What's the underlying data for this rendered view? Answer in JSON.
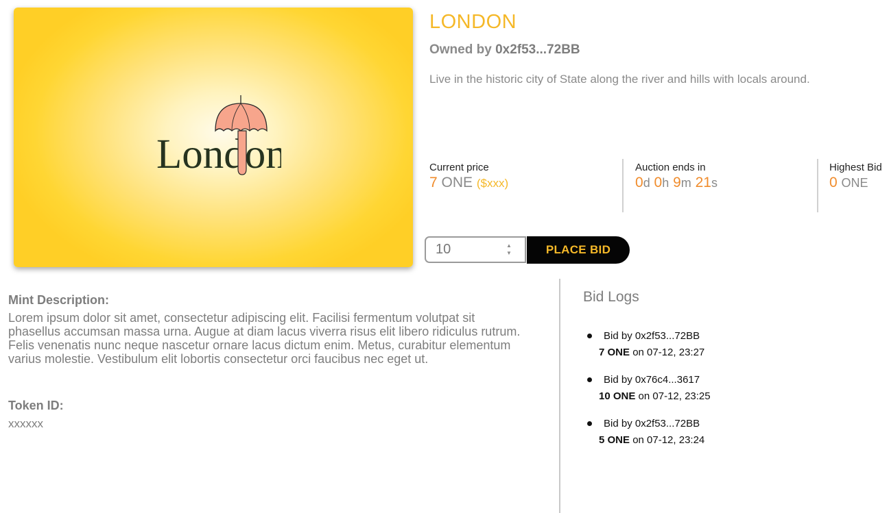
{
  "nft": {
    "image_text": "London",
    "icon": "umbrella-icon",
    "colors": {
      "background": "#ffd633",
      "umbrella": "#f7a58c",
      "text": "#26331f"
    }
  },
  "title": "LONDON",
  "owner": {
    "prefix": "Owned by",
    "address": "0x2f53...72BB"
  },
  "description": "Live in the historic city of State along the river and hills with locals around.",
  "stats": {
    "current_price": {
      "label": "Current price",
      "amount": "7",
      "currency": "ONE",
      "usd": "($xxx)"
    },
    "auction_ends": {
      "label": "Auction ends in",
      "days": "0",
      "days_unit": "d",
      "hours": "0",
      "hours_unit": "h",
      "minutes": "9",
      "minutes_unit": "m",
      "seconds": "21",
      "seconds_unit": "s"
    },
    "highest_bid": {
      "label": "Highest Bid",
      "amount": "0",
      "currency": "ONE"
    }
  },
  "bid_form": {
    "value": "10",
    "button_label": "PLACE BID"
  },
  "mint": {
    "heading": "Mint Description:",
    "text": "Lorem ipsum dolor sit amet, consectetur adipiscing elit. Facilisi fermentum volutpat sit phasellus accumsan massa urna. Augue at diam lacus viverra risus elit libero ridiculus rutrum. Felis venenatis nunc neque nascetur ornare lacus dictum enim. Metus, curabitur elementum varius molestie. Vestibulum elit lobortis consectetur orci faucibus nec eget ut."
  },
  "token": {
    "heading": "Token ID:",
    "value": "xxxxxx"
  },
  "bid_logs": {
    "title": "Bid Logs",
    "entries": [
      {
        "by": "Bid by 0x2f53...72BB",
        "amount": "7 ONE",
        "when": "on 07-12, 23:27"
      },
      {
        "by": "Bid by 0x76c4...3617",
        "amount": "10 ONE",
        "when": "on 07-12, 23:25"
      },
      {
        "by": "Bid by 0x2f53...72BB",
        "amount": "5 ONE",
        "when": "on 07-12, 23:24"
      }
    ]
  },
  "colors": {
    "accent_yellow": "#f5b828",
    "accent_orange": "#f08c2c",
    "button_bg": "#050505"
  }
}
